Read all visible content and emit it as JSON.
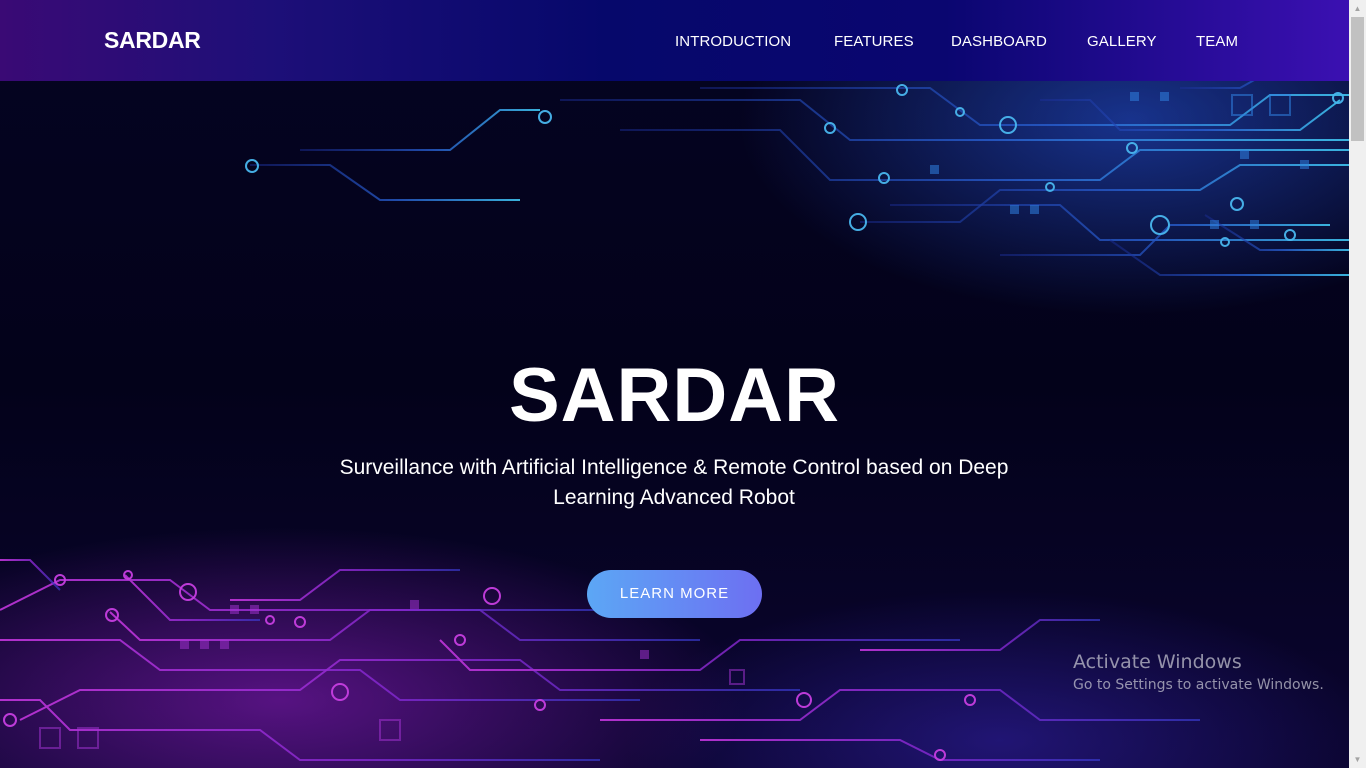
{
  "navbar": {
    "brand": "SARDAR",
    "items": [
      {
        "label": "INTRODUCTION"
      },
      {
        "label": "FEATURES"
      },
      {
        "label": "DASHBOARD"
      },
      {
        "label": "GALLERY"
      },
      {
        "label": "TEAM"
      }
    ]
  },
  "hero": {
    "title": "SARDAR",
    "subtitle": "Surveillance with Artificial Intelligence & Remote Control based on Deep Learning Advanced Robot",
    "button_label": "LEARN MORE"
  },
  "watermark": {
    "title": "Activate Windows",
    "subtitle": "Go to Settings to activate Windows."
  },
  "colors": {
    "nav_gradient_start": "#3a0a75",
    "nav_gradient_end": "#3b10b2",
    "button_gradient_start": "#5ca7f5",
    "button_gradient_end": "#6d6ff2",
    "circuit_top": "#2f8ee8",
    "circuit_bottom": "#b531d6"
  }
}
